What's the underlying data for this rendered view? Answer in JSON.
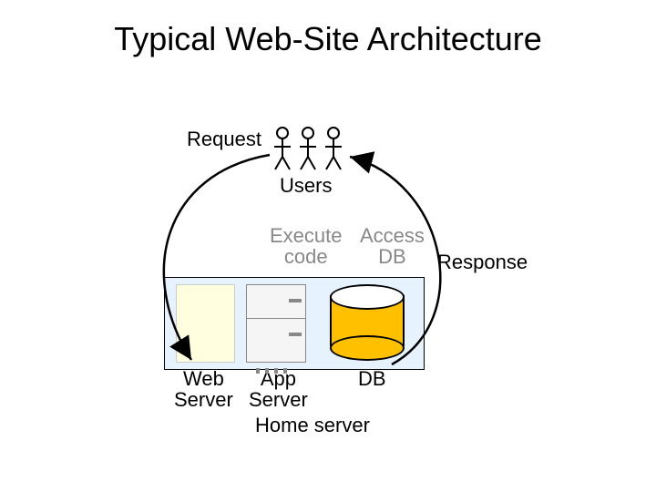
{
  "title": "Typical Web-Site Architecture",
  "labels": {
    "request": "Request",
    "users": "Users",
    "execute_code": "Execute\ncode",
    "access_db": "Access\nDB",
    "response": "Response",
    "web_server": "Web\nServer",
    "app_server": "App\nServer",
    "db": "DB",
    "home_server": "Home server"
  },
  "icons": {
    "users": "stick-figures",
    "web_server": "beige-box",
    "app_server": "server-rack",
    "db": "cylinder"
  },
  "colors": {
    "panel_bg": "#e6f3ff",
    "db_fill": "#ffc000",
    "muted": "#888888"
  }
}
